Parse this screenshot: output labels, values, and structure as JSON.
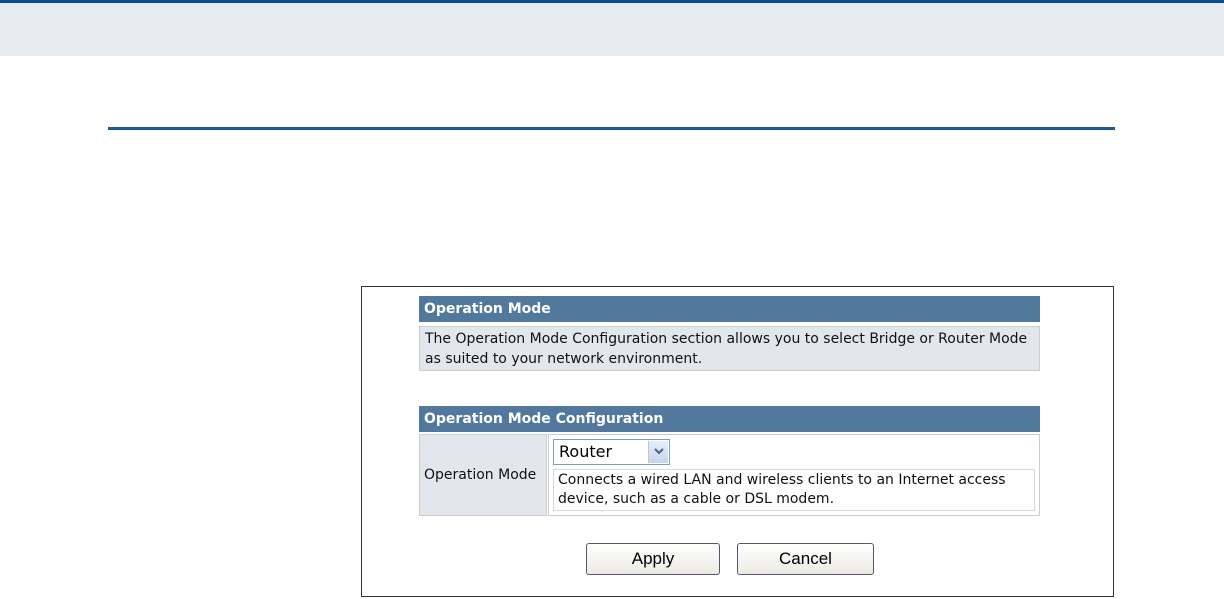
{
  "sections": {
    "info": {
      "title": "Operation Mode",
      "description": "The Operation Mode Configuration section allows you to select Bridge or Router Mode as suited to your network environment."
    },
    "config": {
      "title": "Operation Mode Configuration",
      "field_label": "Operation Mode",
      "selected_mode": "Router",
      "mode_description": "Connects a wired LAN and wireless clients to an Internet access device, such as a cable or DSL modem."
    }
  },
  "buttons": {
    "apply": "Apply",
    "cancel": "Cancel"
  },
  "icons": {
    "dropdown": "chevron-down-icon"
  },
  "colors": {
    "header_bg": "#52789e",
    "cell_bg": "#e2e7ee",
    "accent_rule": "#1d5a96"
  }
}
